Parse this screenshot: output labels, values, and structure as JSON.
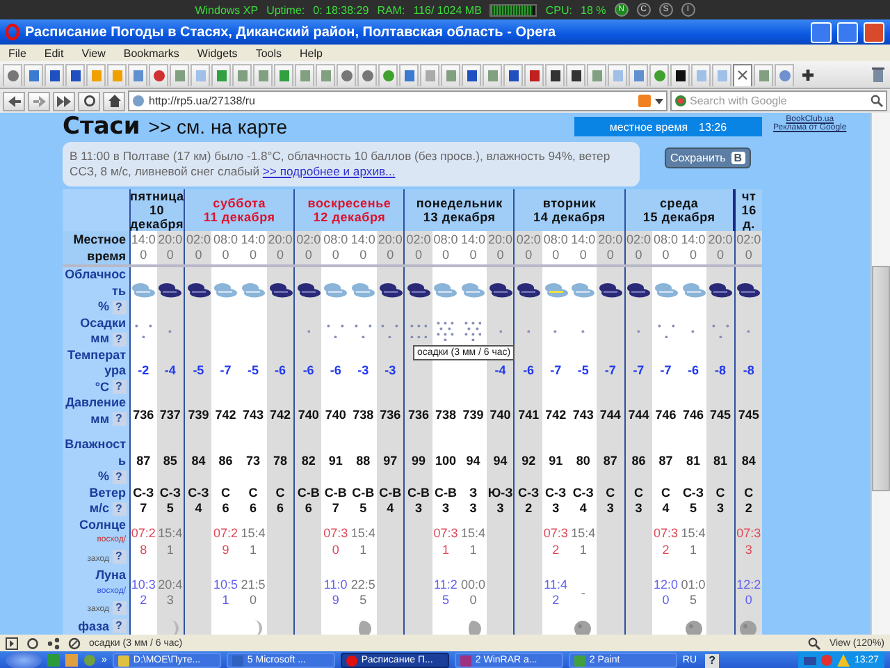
{
  "system_bar": {
    "os": "Windows XP",
    "uptime_label": "Uptime:",
    "uptime": "0: 18:38:29",
    "ram_label": "RAM:",
    "ram": "116/ 1024 MB",
    "ram_meter": {
      "level": 0.92
    },
    "cpu_label": "CPU:",
    "cpu": "18 %",
    "buttons": [
      "N",
      "C",
      "S",
      "I"
    ]
  },
  "window": {
    "title": "Расписание Погоды в Стасях, Диканский район, Полтавская область - Opera"
  },
  "menu": [
    "File",
    "Edit",
    "View",
    "Bookmarks",
    "Widgets",
    "Tools",
    "Help"
  ],
  "tabs": [
    {
      "kind": "minus",
      "selected": false
    },
    {
      "kind": "people",
      "selected": false
    },
    {
      "kind": "flag",
      "selected": false
    },
    {
      "kind": "flag",
      "selected": false
    },
    {
      "kind": "burst",
      "selected": false
    },
    {
      "kind": "burst",
      "selected": false
    },
    {
      "kind": "doc",
      "selected": false
    },
    {
      "kind": "ring",
      "selected": false
    },
    {
      "kind": "page",
      "selected": false
    },
    {
      "kind": "chat",
      "selected": false
    },
    {
      "kind": "google",
      "selected": false
    },
    {
      "kind": "page",
      "selected": false
    },
    {
      "kind": "page",
      "selected": false
    },
    {
      "kind": "google",
      "selected": false
    },
    {
      "kind": "page",
      "selected": false
    },
    {
      "kind": "page",
      "selected": false
    },
    {
      "kind": "minus",
      "selected": false
    },
    {
      "kind": "minus",
      "selected": false
    },
    {
      "kind": "plus",
      "selected": false
    },
    {
      "kind": "people",
      "selected": false
    },
    {
      "kind": "dots",
      "selected": false
    },
    {
      "kind": "page",
      "selected": false
    },
    {
      "kind": "flag",
      "selected": false
    },
    {
      "kind": "page",
      "selected": false
    },
    {
      "kind": "flag",
      "selected": false
    },
    {
      "kind": "red",
      "selected": false
    },
    {
      "kind": "tree",
      "selected": false
    },
    {
      "kind": "tree",
      "selected": false
    },
    {
      "kind": "page",
      "selected": false
    },
    {
      "kind": "chat",
      "selected": false
    },
    {
      "kind": "doc",
      "selected": false
    },
    {
      "kind": "plus",
      "selected": false
    },
    {
      "kind": "black",
      "selected": false
    },
    {
      "kind": "chat",
      "selected": false
    },
    {
      "kind": "chat",
      "selected": false
    },
    {
      "kind": "close",
      "selected": true
    },
    {
      "kind": "page",
      "selected": false
    },
    {
      "kind": "globe",
      "selected": false
    }
  ],
  "address": {
    "url": "http://rp5.ua/27138/ru",
    "search_placeholder": "Search with Google"
  },
  "page": {
    "place": "Стаси",
    "map_link": ">> см. на карте",
    "local_time_label": "местное время",
    "local_time": "13:26",
    "ads": [
      "BookClub.ua",
      "Реклама от Google"
    ],
    "summary": "В 11:00 в Полтаве (17 км) было -1.8°C, облачность 10 баллов (без просв.), влажность 94%, ветер ССЗ, 8 м/с, ливневой снег слабый",
    "summary_link": ">> подробнее и архив...",
    "save_button": "Сохранить",
    "save_badge": "В"
  },
  "row_labels": {
    "time": "Местное время",
    "cloud": "Облачность",
    "cloud_unit": "%",
    "precip": "Осадки",
    "precip_unit": "мм",
    "temp": "Температура",
    "temp_unit": "°C",
    "pressure": "Давление",
    "pressure_unit": "мм",
    "humidity": "Влажность",
    "humidity_unit": "%",
    "wind": "Ветер",
    "wind_unit": "м/с",
    "sun": "Солнце",
    "sun_sub1": "восход/",
    "sun_sub2": "заход",
    "moon": "Луна",
    "moon_sub1": "восход/",
    "moon_sub2": "заход",
    "phase": "фаза",
    "help": "?"
  },
  "days": [
    {
      "weekday": "пятница",
      "date": "10 декабря",
      "weekend": false,
      "columns": [
        {
          "time": "14:00",
          "shaded": false,
          "cloud": {
            "kind": "light"
          },
          "snow": {
            "kind": "light"
          },
          "temp": "-2",
          "pressure": "736",
          "humidity": "87",
          "wind_dir": "С-З",
          "wind_speed": "7",
          "sun": {
            "kind": "rise",
            "time": "07:28"
          },
          "moon": {
            "kind": "rise",
            "time": "10:32"
          }
        },
        {
          "time": "20:00",
          "shaded": true,
          "cloud": {
            "kind": "dark"
          },
          "snow": {
            "kind": "trace"
          },
          "temp": "-4",
          "pressure": "737",
          "humidity": "85",
          "wind_dir": "С-З",
          "wind_speed": "5",
          "sun": {
            "kind": "set",
            "time": "15:41"
          },
          "moon": {
            "kind": "set",
            "time": "20:43"
          },
          "phase": {
            "kind": "crescent"
          }
        }
      ]
    },
    {
      "weekday": "суббота",
      "date": "11 декабря",
      "weekend": true,
      "columns": [
        {
          "time": "02:00",
          "shaded": true,
          "cloud": {
            "kind": "dark"
          },
          "snow": {
            "kind": "none"
          },
          "temp": "-5",
          "pressure": "739",
          "humidity": "84",
          "wind_dir": "С-З",
          "wind_speed": "4"
        },
        {
          "time": "08:00",
          "shaded": false,
          "cloud": {
            "kind": "light"
          },
          "snow": {
            "kind": "none"
          },
          "temp": "-7",
          "pressure": "742",
          "humidity": "86",
          "wind_dir": "С",
          "wind_speed": "6",
          "sun": {
            "kind": "rise",
            "time": "07:29"
          },
          "moon": {
            "kind": "rise",
            "time": "10:51"
          }
        },
        {
          "time": "14:00",
          "shaded": false,
          "cloud": {
            "kind": "light"
          },
          "snow": {
            "kind": "none"
          },
          "temp": "-5",
          "pressure": "743",
          "humidity": "73",
          "wind_dir": "С",
          "wind_speed": "6",
          "sun": {
            "kind": "set",
            "time": "15:41"
          },
          "moon": {
            "kind": "set",
            "time": "21:50"
          },
          "phase": {
            "kind": "crescent"
          }
        },
        {
          "time": "20:00",
          "shaded": true,
          "cloud": {
            "kind": "dark"
          },
          "snow": {
            "kind": "none"
          },
          "temp": "-6",
          "pressure": "742",
          "humidity": "78",
          "wind_dir": "С",
          "wind_speed": "6"
        }
      ]
    },
    {
      "weekday": "воскресенье",
      "date": "12 декабря",
      "weekend": true,
      "columns": [
        {
          "time": "02:00",
          "shaded": true,
          "cloud": {
            "kind": "dark"
          },
          "snow": {
            "kind": "trace"
          },
          "temp": "-6",
          "pressure": "740",
          "humidity": "82",
          "wind_dir": "С-В",
          "wind_speed": "6"
        },
        {
          "time": "08:00",
          "shaded": false,
          "cloud": {
            "kind": "light"
          },
          "snow": {
            "kind": "light"
          },
          "temp": "-6",
          "pressure": "740",
          "humidity": "91",
          "wind_dir": "С-В",
          "wind_speed": "7",
          "sun": {
            "kind": "rise",
            "time": "07:30"
          },
          "moon": {
            "kind": "rise",
            "time": "11:09"
          }
        },
        {
          "time": "14:00",
          "shaded": false,
          "cloud": {
            "kind": "light"
          },
          "snow": {
            "kind": "light"
          },
          "temp": "-3",
          "pressure": "738",
          "humidity": "88",
          "wind_dir": "С-В",
          "wind_speed": "5",
          "sun": {
            "kind": "set",
            "time": "15:41"
          },
          "moon": {
            "kind": "set",
            "time": "22:55"
          },
          "phase": {
            "kind": "gibbous"
          }
        },
        {
          "time": "20:00",
          "shaded": true,
          "cloud": {
            "kind": "dark"
          },
          "snow": {
            "kind": "light"
          },
          "temp": "-3",
          "pressure": "736",
          "humidity": "97",
          "wind_dir": "С-В",
          "wind_speed": "4"
        }
      ]
    },
    {
      "weekday": "понедельник",
      "date": "13 декабря",
      "weekend": false,
      "columns": [
        {
          "time": "02:00",
          "shaded": true,
          "cloud": {
            "kind": "dark"
          },
          "snow": {
            "kind": "moderate"
          },
          "pressure": "736",
          "humidity": "99",
          "wind_dir": "С-В",
          "wind_speed": "3"
        },
        {
          "time": "08:00",
          "shaded": false,
          "cloud": {
            "kind": "light"
          },
          "snow": {
            "kind": "heavy"
          },
          "pressure": "738",
          "humidity": "100",
          "wind_dir": "С-В",
          "wind_speed": "3",
          "sun": {
            "kind": "rise",
            "time": "07:31"
          },
          "moon": {
            "kind": "rise",
            "time": "11:25"
          }
        },
        {
          "time": "14:00",
          "shaded": false,
          "cloud": {
            "kind": "light"
          },
          "snow": {
            "kind": "heavy"
          },
          "pressure": "739",
          "humidity": "94",
          "wind_dir": "З",
          "wind_speed": "3",
          "sun": {
            "kind": "set",
            "time": "15:41"
          },
          "moon": {
            "kind": "set",
            "time": "00:00"
          },
          "phase": {
            "kind": "gibbous"
          }
        },
        {
          "time": "20:00",
          "shaded": true,
          "cloud": {
            "kind": "dark"
          },
          "snow": {
            "kind": "trace"
          },
          "temp": "-4",
          "pressure": "740",
          "humidity": "94",
          "wind_dir": "Ю-З",
          "wind_speed": "3"
        }
      ]
    },
    {
      "weekday": "вторник",
      "date": "14 декабря",
      "weekend": false,
      "columns": [
        {
          "time": "02:00",
          "shaded": true,
          "cloud": {
            "kind": "dark"
          },
          "snow": {
            "kind": "trace"
          },
          "temp": "-6",
          "pressure": "741",
          "humidity": "92",
          "wind_dir": "С-З",
          "wind_speed": "2"
        },
        {
          "time": "08:00",
          "shaded": false,
          "cloud": {
            "kind": "sunny"
          },
          "snow": {
            "kind": "trace"
          },
          "temp": "-7",
          "pressure": "742",
          "humidity": "91",
          "wind_dir": "С-З",
          "wind_speed": "3",
          "sun": {
            "kind": "rise",
            "time": "07:32"
          },
          "moon": {
            "kind": "rise",
            "time": "11:42"
          }
        },
        {
          "time": "14:00",
          "shaded": false,
          "cloud": {
            "kind": "light"
          },
          "snow": {
            "kind": "trace"
          },
          "temp": "-5",
          "pressure": "743",
          "humidity": "80",
          "wind_dir": "С-З",
          "wind_speed": "4",
          "sun": {
            "kind": "set",
            "time": "15:41"
          },
          "moon": {
            "kind": "set",
            "time": "-"
          },
          "phase": {
            "kind": "full"
          }
        },
        {
          "time": "20:00",
          "shaded": true,
          "cloud": {
            "kind": "dark"
          },
          "snow": {
            "kind": "none"
          },
          "temp": "-7",
          "pressure": "744",
          "humidity": "87",
          "wind_dir": "С",
          "wind_speed": "3"
        }
      ]
    },
    {
      "weekday": "среда",
      "date": "15 декабря",
      "weekend": false,
      "columns": [
        {
          "time": "02:00",
          "shaded": true,
          "cloud": {
            "kind": "dark"
          },
          "snow": {
            "kind": "trace"
          },
          "temp": "-7",
          "pressure": "744",
          "humidity": "86",
          "wind_dir": "С",
          "wind_speed": "3"
        },
        {
          "time": "08:00",
          "shaded": false,
          "cloud": {
            "kind": "light"
          },
          "snow": {
            "kind": "light"
          },
          "temp": "-7",
          "pressure": "746",
          "humidity": "87",
          "wind_dir": "С",
          "wind_speed": "4",
          "sun": {
            "kind": "rise",
            "time": "07:32"
          },
          "moon": {
            "kind": "rise",
            "time": "12:00"
          }
        },
        {
          "time": "14:00",
          "shaded": false,
          "cloud": {
            "kind": "light"
          },
          "snow": {
            "kind": "trace"
          },
          "temp": "-6",
          "pressure": "746",
          "humidity": "81",
          "wind_dir": "С-З",
          "wind_speed": "5",
          "sun": {
            "kind": "set",
            "time": "15:41"
          },
          "moon": {
            "kind": "set",
            "time": "01:05"
          },
          "phase": {
            "kind": "full"
          }
        },
        {
          "time": "20:00",
          "shaded": true,
          "cloud": {
            "kind": "dark"
          },
          "snow": {
            "kind": "light"
          },
          "temp": "-8",
          "pressure": "745",
          "humidity": "81",
          "wind_dir": "С",
          "wind_speed": "3"
        }
      ]
    },
    {
      "weekday": "чт",
      "date": "16 д.",
      "weekend": false,
      "columns": [
        {
          "time": "02:00",
          "shaded": true,
          "cloud": {
            "kind": "dark"
          },
          "snow": {
            "kind": "trace"
          },
          "temp": "-8",
          "pressure": "745",
          "humidity": "84",
          "wind_dir": "С",
          "wind_speed": "2",
          "sun": {
            "kind": "rise",
            "time": "07:33"
          },
          "moon": {
            "kind": "rise",
            "time": "12:20"
          },
          "phase": {
            "kind": "full"
          }
        }
      ]
    }
  ],
  "tooltip": "осадки (3 мм / 6 час)",
  "status_bar": {
    "text": "осадки (3 мм / 6 час)",
    "zoom": "View (120%)"
  },
  "taskbar": {
    "more": "»",
    "tasks": [
      {
        "label": "D:\\MOE\\Путе...",
        "kind": "folder",
        "active": false
      },
      {
        "label": "5 Microsoft ...",
        "kind": "word",
        "active": false
      },
      {
        "label": "Расписание П...",
        "kind": "opera",
        "active": true
      },
      {
        "label": "2 WinRAR a...",
        "kind": "rar",
        "active": false
      },
      {
        "label": "2 Paint",
        "kind": "paint",
        "active": false
      }
    ],
    "language": "RU",
    "help": "?",
    "clock": "13:27"
  }
}
